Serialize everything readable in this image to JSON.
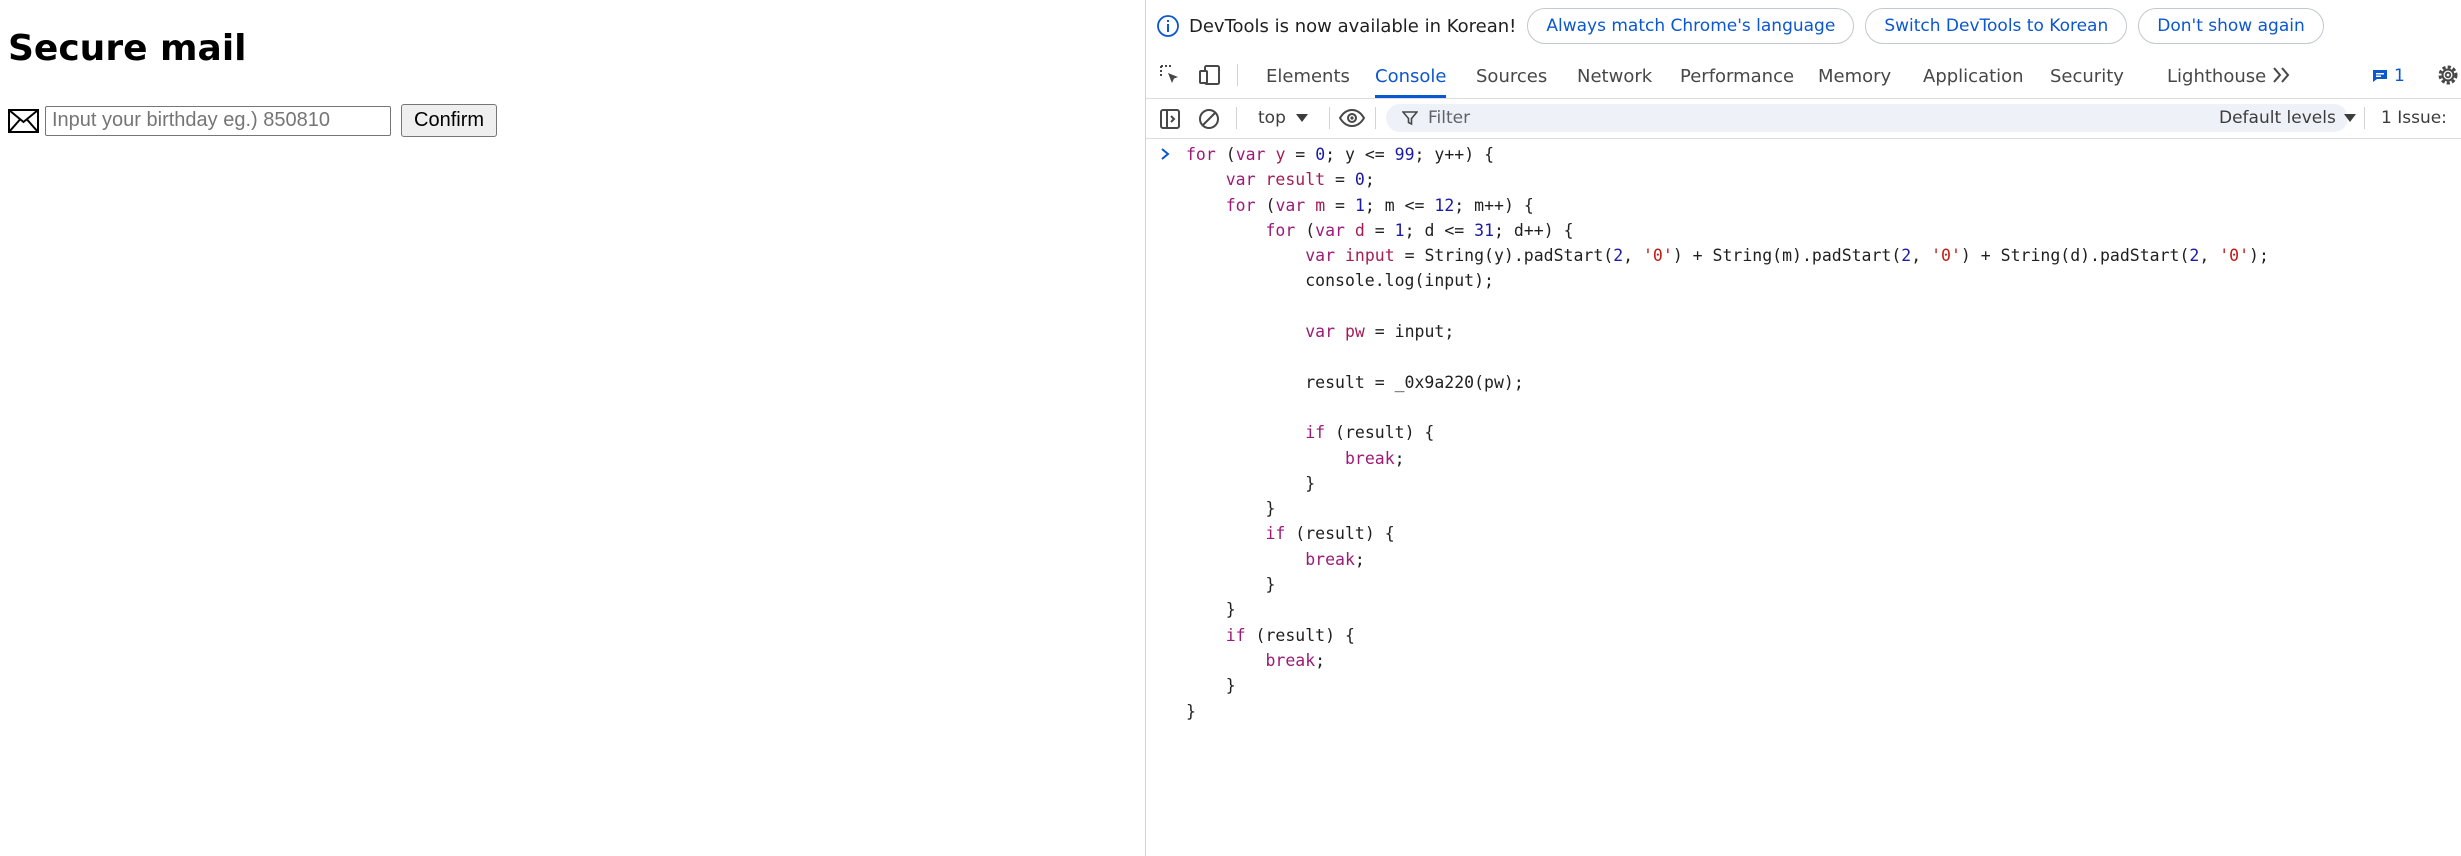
{
  "page": {
    "title": "Secure mail",
    "input": {
      "value": "",
      "placeholder": "Input your birthday eg.) 850810"
    },
    "confirm_label": "Confirm",
    "icons": {
      "mail": "envelope-icon"
    }
  },
  "devtools": {
    "infobar": {
      "message": "DevTools is now available in Korean!",
      "buttons": [
        "Always match Chrome's language",
        "Switch DevTools to Korean",
        "Don't show again"
      ]
    },
    "tabs": [
      "Elements",
      "Console",
      "Sources",
      "Network",
      "Performance",
      "Memory",
      "Application",
      "Security",
      "Lighthouse"
    ],
    "active_tab": "Console",
    "issues_badge": "1",
    "toolbar": {
      "context": "top",
      "filter_placeholder": "Filter",
      "levels": "Default levels",
      "issues": "1 Issue:"
    },
    "console_code_lines": [
      "for (var y = 0; y <= 99; y++) {",
      "    var result = 0;",
      "    for (var m = 1; m <= 12; m++) {",
      "        for (var d = 1; d <= 31; d++) {",
      "            var input = String(y).padStart(2, '0') + String(m).padStart(2, '0') + String(d).padStart(2, '0');",
      "            console.log(input);",
      "",
      "            var pw = input;",
      "",
      "            result = _0x9a220(pw);",
      "",
      "            if (result) {",
      "                break;",
      "            }",
      "        }",
      "        if (result) {",
      "            break;",
      "        }",
      "    }",
      "    if (result) {",
      "        break;",
      "    }",
      "}"
    ],
    "colors": {
      "accent": "#0b57d0",
      "keyword": "#9c1b77",
      "number": "#1a1aa6",
      "string": "#c41a16"
    }
  }
}
